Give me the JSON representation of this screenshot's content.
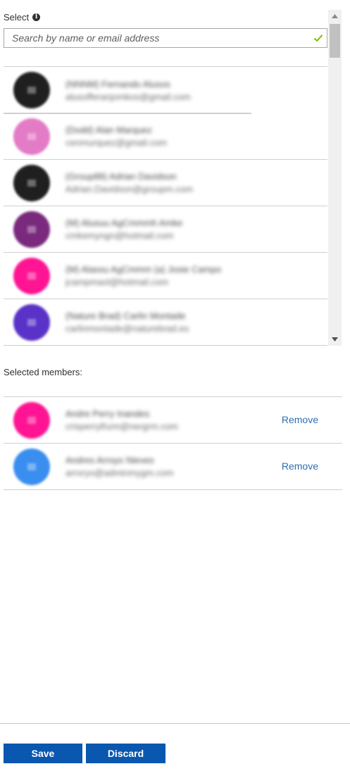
{
  "select": {
    "label": "Select",
    "info_icon": "info-icon",
    "search_placeholder": "Search by name or email address",
    "valid_icon": "checkmark-icon",
    "valid_color": "#7fba00"
  },
  "results": [
    {
      "name": "(NNNM) Fernando Alusos",
      "email": "alusofferanjomkos@gmail.com",
      "avatar_color": "#1f1f1f"
    },
    {
      "name": "(Dodd) Alan Marquez",
      "email": "cenmurquez@gmail.com",
      "avatar_color": "#e37bc7"
    },
    {
      "name": "(Group88) Adrian Davidson",
      "email": "Adrian.Davidson@groupm.com",
      "avatar_color": "#1f1f1f"
    },
    {
      "name": "(M) Alusuu AgCmmmh Amke",
      "email": "cmkemyngn@hotmail.com",
      "avatar_color": "#7a2a7c"
    },
    {
      "name": "(M) Alassu AgCmmm (a) Josie Campo",
      "email": "jcampmaol@hotmail.com",
      "avatar_color": "#ff1493"
    },
    {
      "name": "(Nature Brad) Carlin Montade",
      "email": "carlinmontade@naturebrad.es",
      "avatar_color": "#5a32c8"
    }
  ],
  "selected": {
    "label": "Selected members:",
    "remove_label": "Remove",
    "members": [
      {
        "name": "Andre Perry Inandes",
        "email": "crisperrylhzm@nergrm.com",
        "avatar_color": "#ff1493"
      },
      {
        "name": "Andres Arroyo Nieves",
        "email": "arroryo@adminmygm.com",
        "avatar_color": "#3a8eef"
      }
    ]
  },
  "footer": {
    "save_label": "Save",
    "discard_label": "Discard",
    "button_color": "#0a57b0"
  }
}
